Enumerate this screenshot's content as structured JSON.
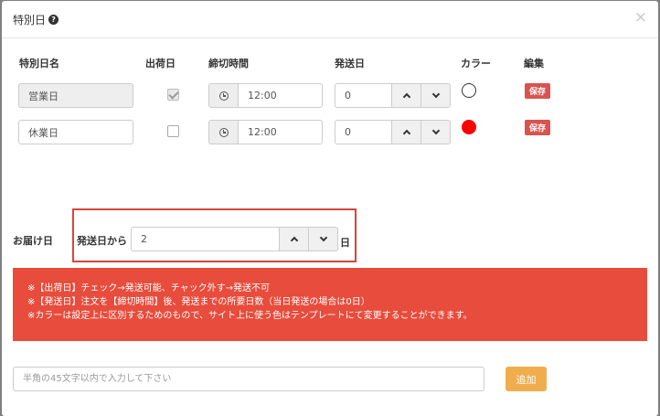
{
  "modal": {
    "title": "特別日",
    "close_glyph": "×"
  },
  "table": {
    "headers": {
      "name": "特別日名",
      "ship_day": "出荷日",
      "cutoff_time": "締切時間",
      "send_day": "発送日",
      "color": "カラー",
      "edit": "編集"
    },
    "rows": [
      {
        "name": "営業日",
        "name_disabled": true,
        "ship_checked": true,
        "cutoff": "12:00",
        "send_days": "0",
        "color": "#ffffff",
        "color_border": "#333333",
        "save_label": "保存"
      },
      {
        "name": "休業日",
        "name_disabled": false,
        "ship_checked": false,
        "cutoff": "12:00",
        "send_days": "0",
        "color": "#ff0000",
        "color_border": "#ff0000",
        "save_label": "保存"
      }
    ]
  },
  "delivery": {
    "label": "お届け日",
    "from_label": "発送日から",
    "value": "2",
    "suffix": "日"
  },
  "notice": {
    "lines": [
      "※【出荷日】チェック→発送可能、チャック外す→発送不可",
      "※【発送日】注文を【締切時間】後、発送までの所要日数（当日発送の場合は0日）",
      "※カラーは設定上に区別するためのもので、サイト上に使う色はテンプレートにて変更することができます。"
    ],
    "background": "#e74c3c"
  },
  "add": {
    "placeholder": "半角の45文字以内で入力して下さい",
    "button_label": "追加"
  }
}
